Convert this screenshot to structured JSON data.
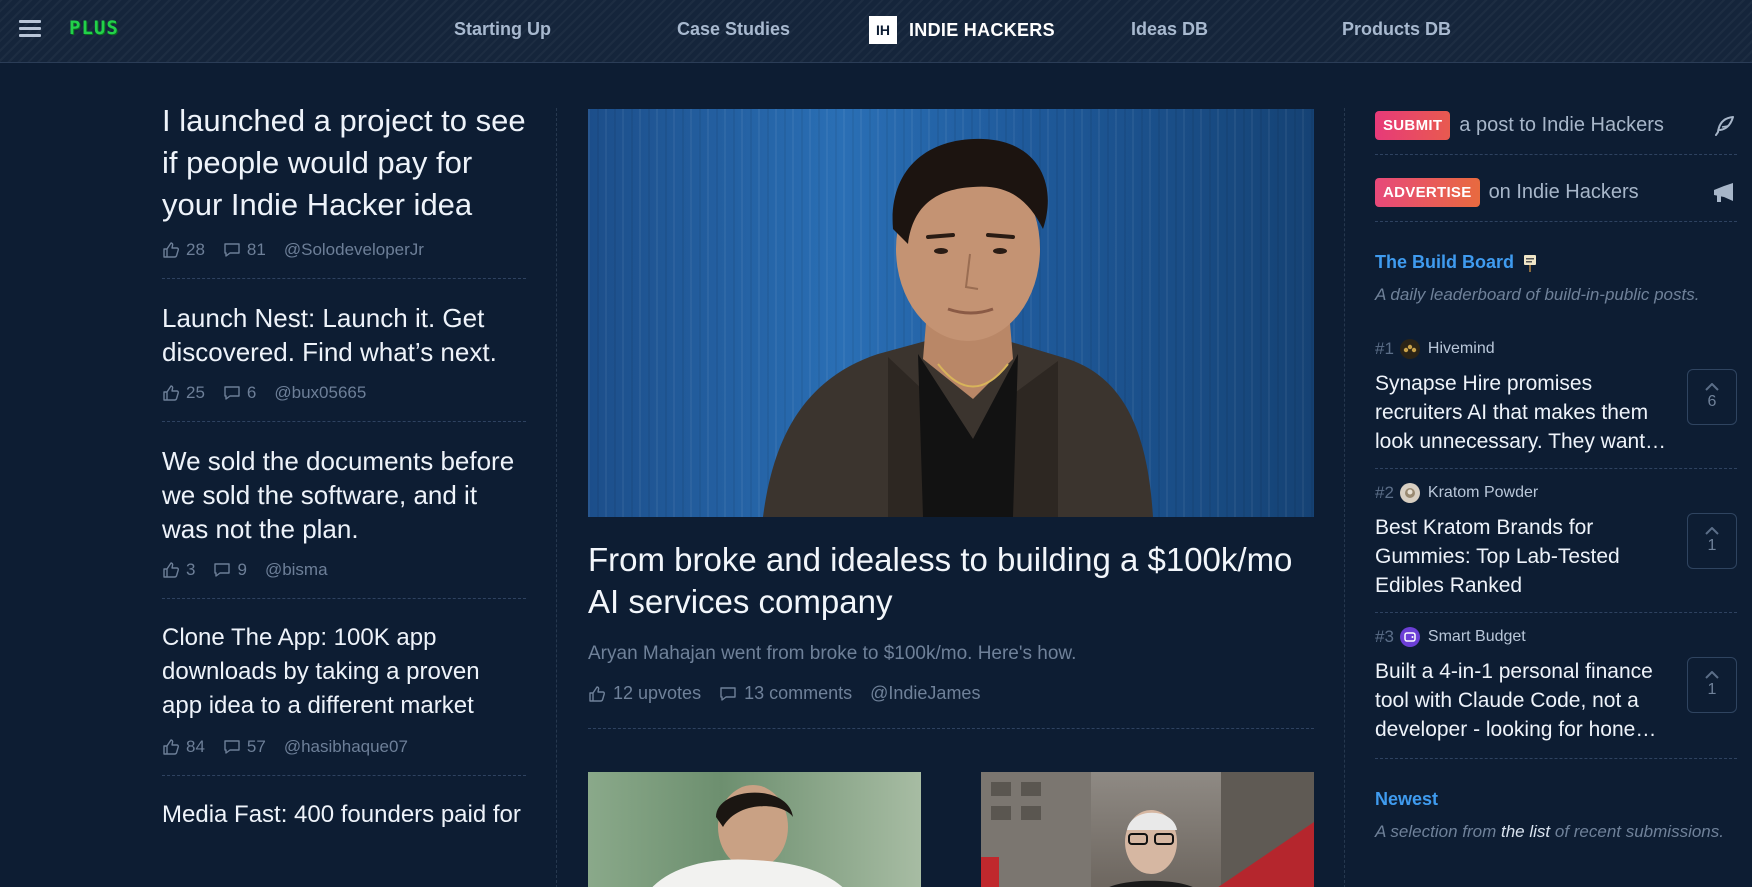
{
  "nav": {
    "plus": "PLUS",
    "links": [
      "Starting Up",
      "Case Studies",
      "Ideas DB",
      "Products DB"
    ],
    "brand_box": "IH",
    "brand": "INDIE HACKERS"
  },
  "left_posts": [
    {
      "title": "I launched a project to see if people would pay for your Indie Hacker idea",
      "likes": "28",
      "comments": "81",
      "author": "@SolodeveloperJr"
    },
    {
      "title": "Launch Nest: Launch it. Get discovered. Find what’s next.",
      "likes": "25",
      "comments": "6",
      "author": "@bux05665"
    },
    {
      "title": "We sold the documents before we sold the software, and it was not the plan.",
      "likes": "3",
      "comments": "9",
      "author": "@bisma"
    },
    {
      "title": "Clone The App: 100K app downloads by taking a proven app idea to a different market",
      "likes": "84",
      "comments": "57",
      "author": "@hasibhaque07"
    },
    {
      "title": "Media Fast: 400 founders paid for",
      "likes": "",
      "comments": "",
      "author": ""
    }
  ],
  "featured": {
    "title": "From broke and idealess to building a $100k/mo AI services company",
    "subtitle": "Aryan Mahajan went from broke to $100k/mo. Here's how.",
    "upvotes": "12 upvotes",
    "comments": "13 comments",
    "author": "@IndieJames"
  },
  "sidebar": {
    "submit_badge": "SUBMIT",
    "submit_text": "a post to Indie Hackers",
    "advertise_badge": "ADVERTISE",
    "advertise_text": "on Indie Hackers",
    "build_board_title": "The Build Board",
    "build_board_desc": "A daily leaderboard of build-in-public posts.",
    "items": [
      {
        "rank": "#1",
        "product": "Hivemind",
        "title": "Synapse Hire promises recruiters AI that makes them look unnecessary. They want…",
        "votes": "6"
      },
      {
        "rank": "#2",
        "product": "Kratom Powder",
        "title": "Best Kratom Brands for Gummies: Top Lab-Tested Edibles Ranked",
        "votes": "1"
      },
      {
        "rank": "#3",
        "product": "Smart Budget",
        "title": "Built a 4-in-1 personal finance tool with Claude Code, not a developer - looking for hone…",
        "votes": "1"
      }
    ],
    "newest_title": "Newest",
    "newest_desc_pre": "A selection from",
    "newest_desc_link": "the list",
    "newest_desc_post": "of recent submissions."
  },
  "colors": {
    "background": "#0d1d33",
    "accent_blue": "#3f9bef",
    "plus_green": "#22d14a",
    "badge_pink": "#e73a79"
  }
}
